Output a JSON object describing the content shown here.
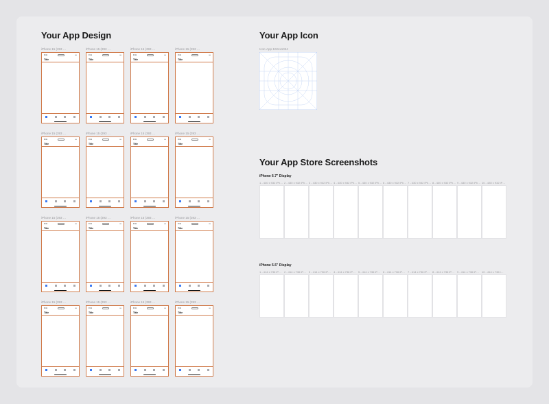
{
  "sections": {
    "design_title": "Your App Design",
    "icon_title": "Your App Icon",
    "shots_title": "Your App Store Screenshots"
  },
  "phone_template": {
    "time": "9:41",
    "nav_title": "Title",
    "dynamic_island": true,
    "tabs": 4
  },
  "design_frames": [
    {
      "label": "iPhone 15 (393 …"
    },
    {
      "label": "iPhone 15 (393 …"
    },
    {
      "label": "iPhone 15 (393 …"
    },
    {
      "label": "iPhone 15 (393 …"
    },
    {
      "label": "iPhone 15 (393 …"
    },
    {
      "label": "iPhone 15 (393 …"
    },
    {
      "label": "iPhone 15 (393 …"
    },
    {
      "label": "iPhone 15 (393 …"
    },
    {
      "label": "iPhone 15 (393 …"
    },
    {
      "label": "iPhone 15 (393 …"
    },
    {
      "label": "iPhone 15 (393 …"
    },
    {
      "label": "iPhone 15 (393 …"
    },
    {
      "label": "iPhone 15 (393 …"
    },
    {
      "label": "iPhone 15 (393 …"
    },
    {
      "label": "iPhone 15 (393 …"
    },
    {
      "label": "iPhone 15 (393 …"
    }
  ],
  "icon": {
    "label": "Icon-App-1024x1024"
  },
  "screenshots": {
    "set1": {
      "heading": "iPhone 6.7\" Display",
      "frames": [
        {
          "label": "1 - 430 x 932 iPh…"
        },
        {
          "label": "2 - 430 x 932 iPh…"
        },
        {
          "label": "3 - 430 x 932 iPh…"
        },
        {
          "label": "4 - 430 x 932 iPh…"
        },
        {
          "label": "5 - 430 x 932 iPh…"
        },
        {
          "label": "6 - 430 x 932 iPh…"
        },
        {
          "label": "7 - 430 x 932 iPh…"
        },
        {
          "label": "8 - 430 x 932 iPh…"
        },
        {
          "label": "9 - 430 x 932 iPh…"
        },
        {
          "label": "10 - 430 x 932 iP…"
        }
      ]
    },
    "set2": {
      "heading": "iPhone 5.5\" Display",
      "frames": [
        {
          "label": "1 - 414 x 736 iP…"
        },
        {
          "label": "2 - 414 x 736 iP…"
        },
        {
          "label": "3 - 414 x 736 iP…"
        },
        {
          "label": "4 - 414 x 736 iP…"
        },
        {
          "label": "5 - 414 x 736 iP…"
        },
        {
          "label": "6 - 414 x 736 iP…"
        },
        {
          "label": "7 - 414 x 736 iP…"
        },
        {
          "label": "8 - 414 x 736 iP…"
        },
        {
          "label": "9 - 414 x 736 iP…"
        },
        {
          "label": "10 - 414 x 736 i…"
        }
      ]
    }
  }
}
